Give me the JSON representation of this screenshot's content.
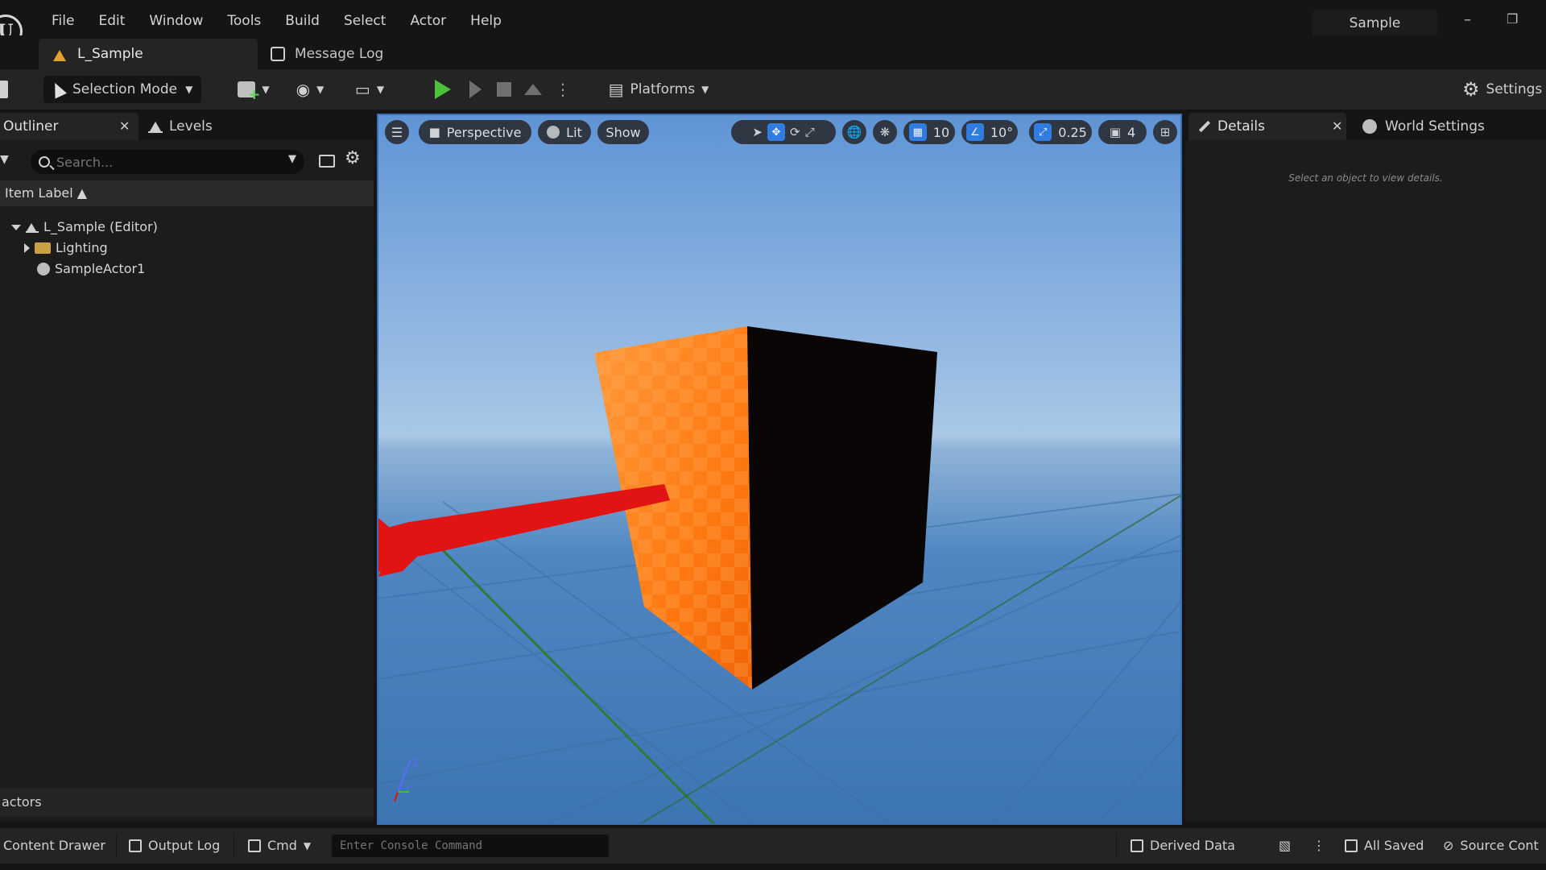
{
  "menu": {
    "items": [
      "File",
      "Edit",
      "Window",
      "Tools",
      "Build",
      "Select",
      "Actor",
      "Help"
    ],
    "project_name": "Sample"
  },
  "tabs": {
    "level_tab": "L_Sample",
    "message_log_tab": "Message Log"
  },
  "toolbar": {
    "selection_mode": "Selection Mode",
    "platforms": "Platforms",
    "settings": "Settings",
    "play_color": "#4cc23a"
  },
  "outliner": {
    "tab_label": "Outliner",
    "levels_tab": "Levels",
    "search_placeholder": "Search...",
    "column_header": "Item Label ▲",
    "items": [
      {
        "label": "L_Sample (Editor)",
        "icon": "level-icon"
      },
      {
        "label": "Lighting",
        "icon": "folder-icon"
      },
      {
        "label": "SampleActor1",
        "icon": "actor-icon"
      }
    ],
    "footer": "actors"
  },
  "viewport": {
    "perspective": "Perspective",
    "lit": "Lit",
    "show": "Show",
    "grid_snap": "10",
    "rotation_snap": "10°",
    "scale_snap": "0.25",
    "camera_speed": "4",
    "axis_z": "Z",
    "accent": "#2d7ae0",
    "cube_color": "#ff8a1f"
  },
  "details": {
    "tab_label": "Details",
    "world_settings_tab": "World Settings",
    "empty_message": "Select an object to view details."
  },
  "statusbar": {
    "content_drawer": "Content Drawer",
    "output_log": "Output Log",
    "cmd": "Cmd",
    "console_placeholder": "Enter Console Command",
    "derived_data": "Derived Data",
    "all_saved": "All Saved",
    "source_control": "Source Cont"
  }
}
